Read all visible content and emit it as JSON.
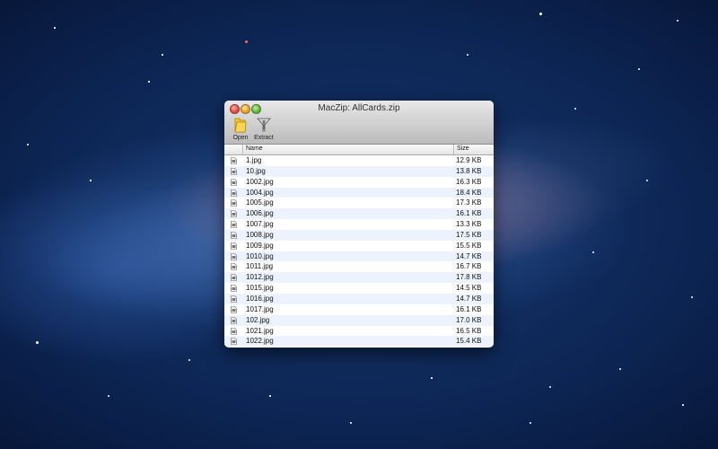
{
  "window": {
    "title": "MacZip: AllCards.zip"
  },
  "toolbar": {
    "open_label": "Open",
    "extract_label": "Extract",
    "open_icon": "folder-icon",
    "extract_icon": "funnel-icon"
  },
  "list": {
    "columns": {
      "name": "Name",
      "size": "Size"
    },
    "file_icon": "file-icon",
    "rows": [
      {
        "name": "1.jpg",
        "size": "12.9 KB"
      },
      {
        "name": "10.jpg",
        "size": "13.8 KB"
      },
      {
        "name": "1002.jpg",
        "size": "16.3 KB"
      },
      {
        "name": "1004.jpg",
        "size": "18.4 KB"
      },
      {
        "name": "1005.jpg",
        "size": "17.3 KB"
      },
      {
        "name": "1006.jpg",
        "size": "16.1 KB"
      },
      {
        "name": "1007.jpg",
        "size": "13.3 KB"
      },
      {
        "name": "1008.jpg",
        "size": "17.5 KB"
      },
      {
        "name": "1009.jpg",
        "size": "15.5 KB"
      },
      {
        "name": "1010.jpg",
        "size": "14.7 KB"
      },
      {
        "name": "1011.jpg",
        "size": "16.7 KB"
      },
      {
        "name": "1012.jpg",
        "size": "17.8 KB"
      },
      {
        "name": "1015.jpg",
        "size": "14.5 KB"
      },
      {
        "name": "1016.jpg",
        "size": "14.7 KB"
      },
      {
        "name": "1017.jpg",
        "size": "16.1 KB"
      },
      {
        "name": "102.jpg",
        "size": "17.0 KB"
      },
      {
        "name": "1021.jpg",
        "size": "16.5 KB"
      },
      {
        "name": "1022.jpg",
        "size": "15.4 KB"
      }
    ]
  },
  "colors": {
    "alt_row": "#edf3fe",
    "close": "#e2463e",
    "minimize": "#e0a323",
    "zoom": "#5fb33a"
  }
}
